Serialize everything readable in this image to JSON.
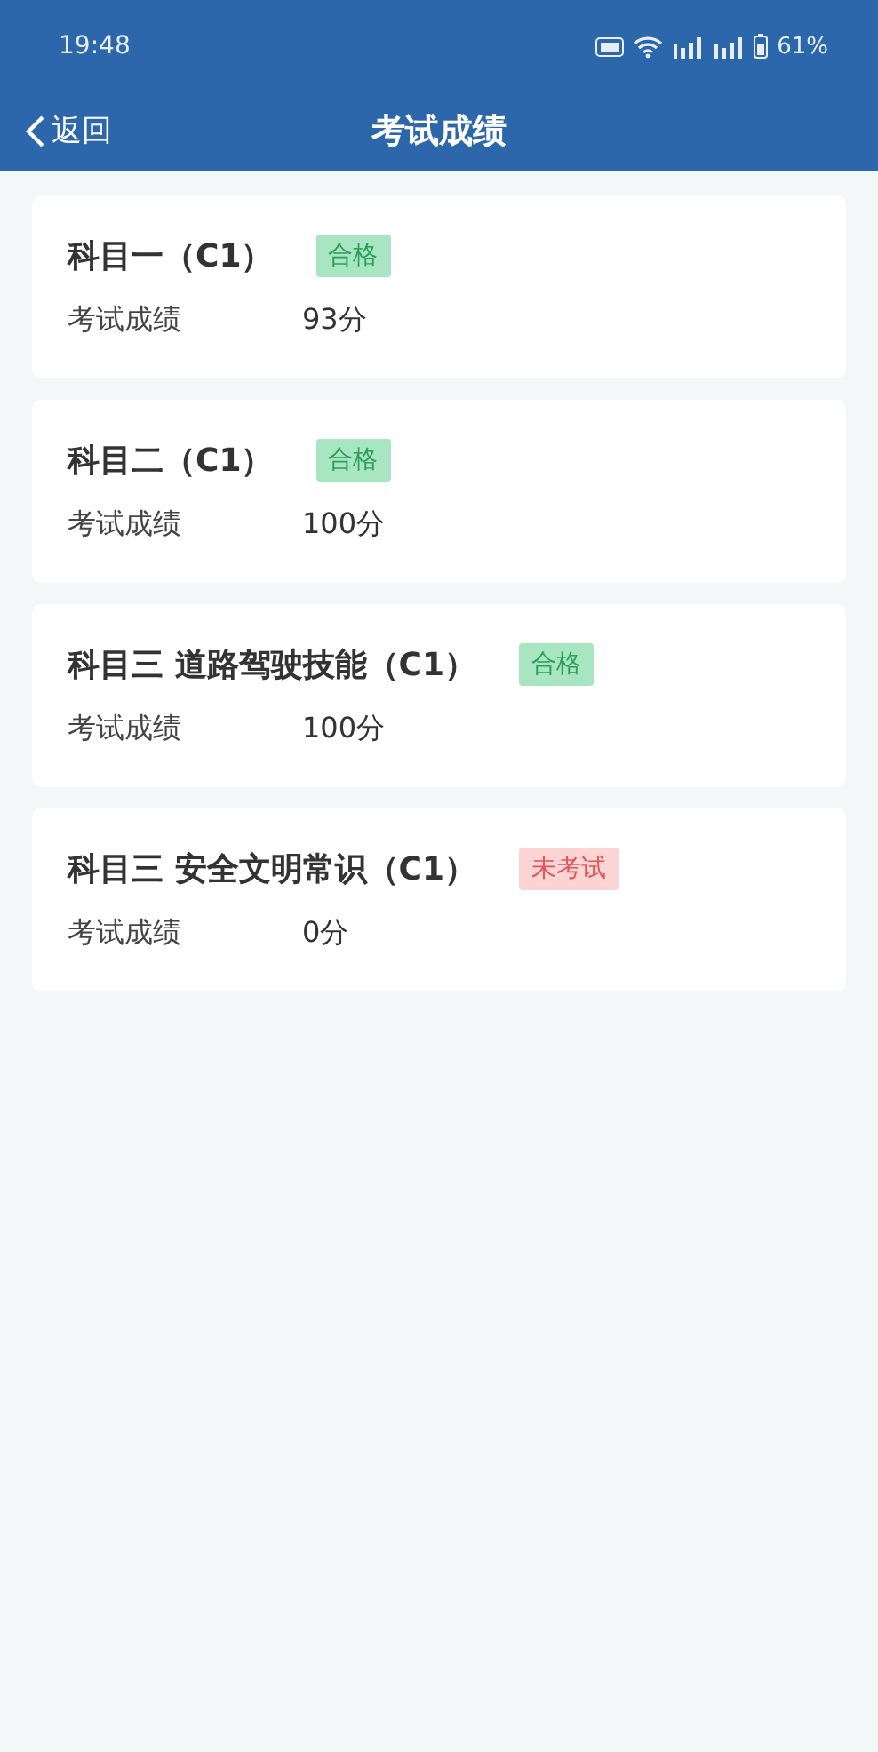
{
  "status_bar": {
    "time": "19:48",
    "battery": "61%"
  },
  "header": {
    "back": "返回",
    "title": "考试成绩"
  },
  "results": [
    {
      "subject": "科目一（C1）",
      "status": {
        "kind": "pass",
        "label": "合格"
      },
      "score_label": "考试成绩",
      "score": "93分"
    },
    {
      "subject": "科目二（C1）",
      "status": {
        "kind": "pass",
        "label": "合格"
      },
      "score_label": "考试成绩",
      "score": "100分"
    },
    {
      "subject": "科目三 道路驾驶技能（C1）",
      "status": {
        "kind": "pass",
        "label": "合格"
      },
      "score_label": "考试成绩",
      "score": "100分"
    },
    {
      "subject": "科目三 安全文明常识（C1）",
      "status": {
        "kind": "absent",
        "label": "未考试"
      },
      "score_label": "考试成绩",
      "score": "0分"
    }
  ]
}
